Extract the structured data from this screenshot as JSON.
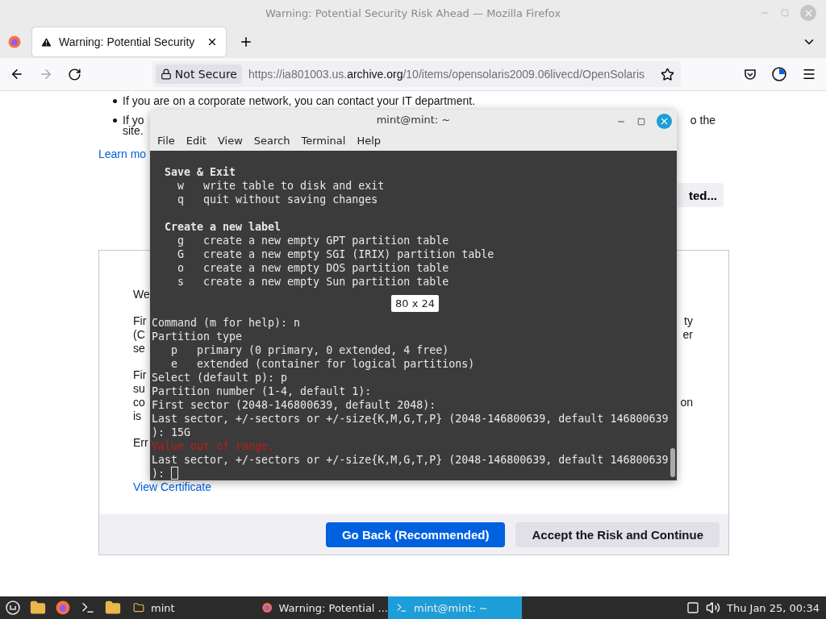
{
  "window": {
    "title": "Warning: Potential Security Risk Ahead — Mozilla Firefox"
  },
  "tabs": [
    {
      "label": "Warning: Potential Security",
      "selected": true
    }
  ],
  "address_bar": {
    "security_label": "Not Secure",
    "url_prefix": "https://ia801003.us.",
    "url_domain": "archive.org",
    "url_path": "/10/items/opensolaris2009.06livecd/OpenSolaris"
  },
  "page": {
    "bullets": [
      {
        "left": "If you are on a corporate network, you can contact your IT department."
      },
      {
        "left": "If yo",
        "right": "o the"
      }
    ],
    "continuation": "site.",
    "learn_more_link": "Learn mo",
    "advanced_button": "ted...",
    "paragraphs": [
      [
        {
          "left": "We"
        }
      ],
      [
        {
          "left": "Fir",
          "right": "ty"
        },
        {
          "left": "(C",
          "right": "er"
        },
        {
          "left": "se"
        }
      ],
      [
        {
          "left": "Fir"
        },
        {
          "left": "su"
        },
        {
          "left": "co",
          "right": "on"
        },
        {
          "left": "is"
        }
      ],
      [
        {
          "left": "Err"
        }
      ]
    ],
    "view_certificate_link": "View Certificate",
    "buttons": [
      {
        "label": "Go Back (Recommended)",
        "kind": "primary"
      },
      {
        "label": "Accept the Risk and Continue",
        "kind": "secondary"
      }
    ]
  },
  "terminal": {
    "title": "mint@mint: ~",
    "menu": [
      "File",
      "Edit",
      "View",
      "Search",
      "Terminal",
      "Help"
    ],
    "lines": [
      {
        "text": "Save & Exit",
        "kind": "heading"
      },
      {
        "text": "  w   write table to disk and exit",
        "kind": "normal"
      },
      {
        "text": "  q   quit without saving changes",
        "kind": "normal"
      },
      {
        "kind": "blank"
      },
      {
        "text": "Create a new label",
        "kind": "heading"
      },
      {
        "text": "  g   create a new empty GPT partition table",
        "kind": "normal"
      },
      {
        "text": "  G   create a new empty SGI (IRIX) partition table",
        "kind": "normal"
      },
      {
        "text": "  o   create a new empty DOS partition table",
        "kind": "normal"
      },
      {
        "text": "  s   create a new empty Sun partition table",
        "kind": "normal"
      },
      {
        "kind": "blank"
      },
      {
        "kind": "blank"
      },
      {
        "text": "Command (m for help): n",
        "kind": "plain"
      },
      {
        "text": "Partition type",
        "kind": "plain"
      },
      {
        "text": "   p   primary (0 primary, 0 extended, 4 free)",
        "kind": "plain"
      },
      {
        "text": "   e   extended (container for logical partitions)",
        "kind": "plain"
      },
      {
        "text": "Select (default p): p",
        "kind": "plain"
      },
      {
        "text": "Partition number (1-4, default 1):",
        "kind": "plain"
      },
      {
        "text": "First sector (2048-146800639, default 2048):",
        "kind": "plain"
      },
      {
        "text": "Last sector, +/-sectors or +/-size{K,M,G,T,P} (2048-146800639, default 146800639",
        "kind": "plain"
      },
      {
        "text": "): 15G",
        "kind": "plain"
      },
      {
        "text": "Value out of range.",
        "kind": "error"
      },
      {
        "text": "Last sector, +/-sectors or +/-size{K,M,G,T,P} (2048-146800639, default 146800639",
        "kind": "plain"
      },
      {
        "text": "): ",
        "kind": "prompt"
      }
    ],
    "size_tooltip": "80 x 24"
  },
  "taskbar": {
    "windows": [
      {
        "label": "mint",
        "kind": "folder",
        "selected": false
      },
      {
        "label": "Warning: Potential ...",
        "kind": "browser",
        "selected": false
      },
      {
        "label": "mint@mint: ~",
        "kind": "terminal",
        "selected": true
      }
    ],
    "clock": "Thu Jan 25, 00:34"
  }
}
